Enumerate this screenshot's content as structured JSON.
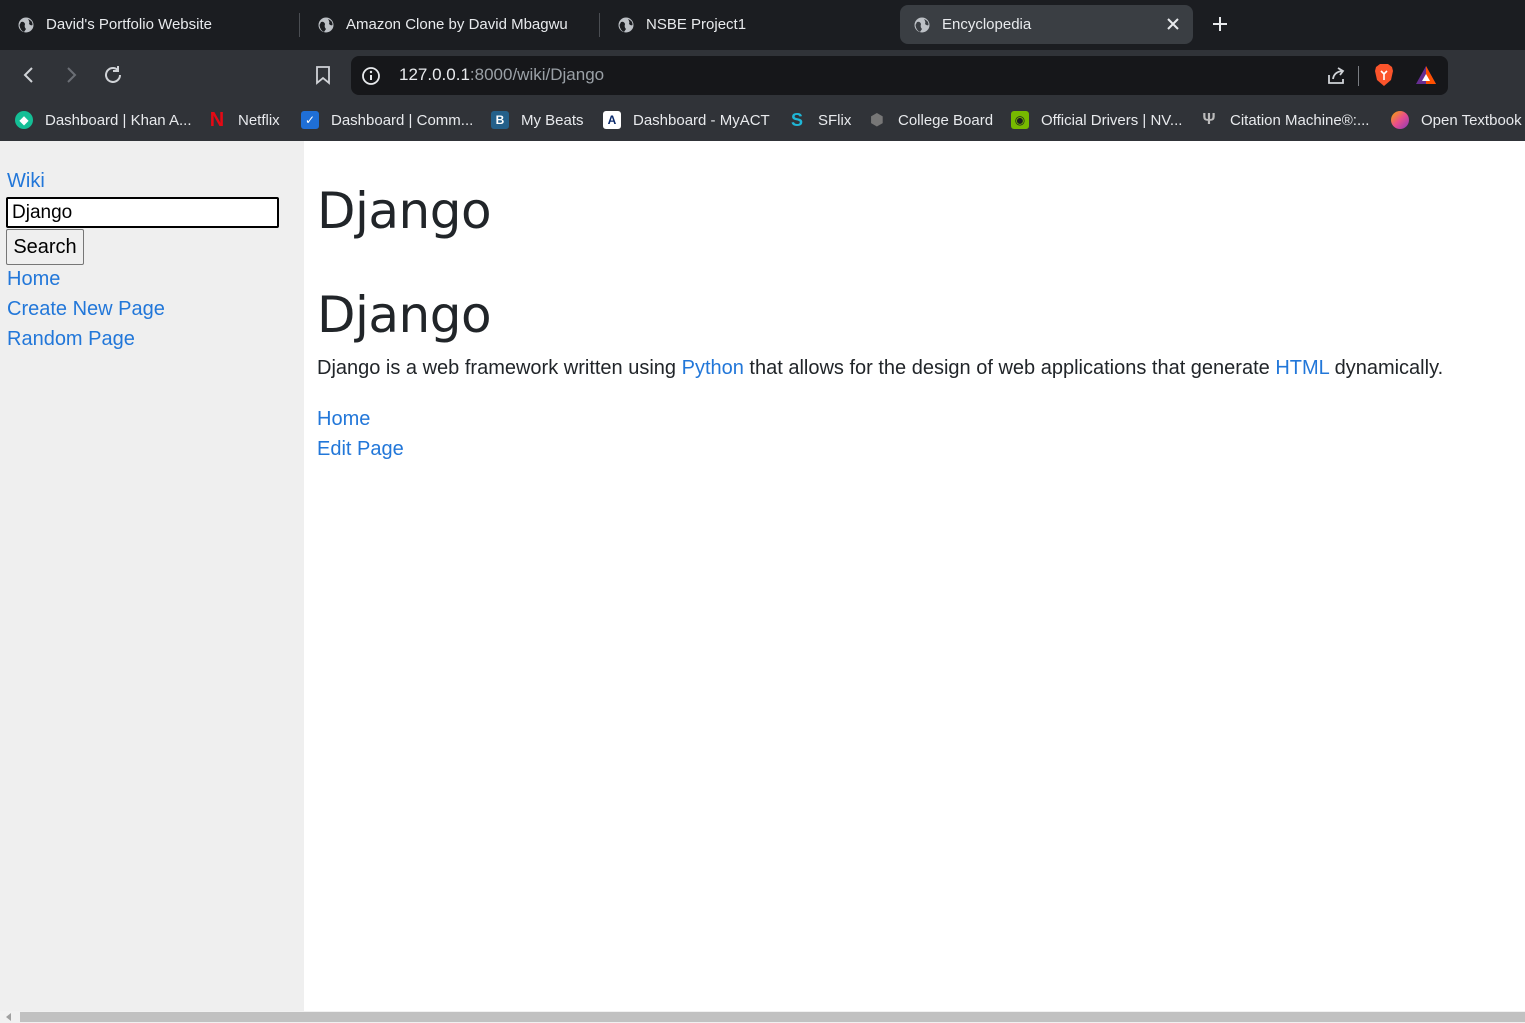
{
  "tabs": [
    {
      "title": "David's Portfolio Website"
    },
    {
      "title": "Amazon Clone by David Mbagwu"
    },
    {
      "title": "NSBE Project1"
    },
    {
      "title": "Encyclopedia"
    }
  ],
  "address_bar": {
    "host": "127.0.0.1",
    "path": ":8000/wiki/Django"
  },
  "bookmarks": [
    {
      "label": "Dashboard | Khan A...",
      "icon": "khan-academy-icon",
      "color": "#14bf96"
    },
    {
      "label": "Netflix",
      "icon": "netflix-icon",
      "color": "#e50914"
    },
    {
      "label": "Dashboard | Comm...",
      "icon": "commonlit-icon",
      "color": "#1f6fd6"
    },
    {
      "label": "My Beats",
      "icon": "beats-icon",
      "color": "#24608a"
    },
    {
      "label": "Dashboard - MyACT",
      "icon": "act-icon",
      "color": "#ffffff"
    },
    {
      "label": "SFlix",
      "icon": "sflix-icon",
      "color": "#1fb6d6"
    },
    {
      "label": "College Board",
      "icon": "collegeboard-icon",
      "color": "#3a3a3a"
    },
    {
      "label": "Official Drivers | NV...",
      "icon": "nvidia-icon",
      "color": "#76b900"
    },
    {
      "label": "Citation Machine®:...",
      "icon": "citation-machine-icon",
      "color": "#bbbbbb"
    },
    {
      "label": "Open Textbook",
      "icon": "open-textbook-icon",
      "color": "#e94e8c"
    }
  ],
  "sidebar": {
    "wiki_label": "Wiki",
    "search_value": "Django",
    "search_button": "Search",
    "links": [
      {
        "label": "Home"
      },
      {
        "label": "Create New Page"
      },
      {
        "label": "Random Page"
      }
    ]
  },
  "main": {
    "page_title": "Django",
    "article_heading": "Django",
    "paragraph": {
      "before": "Django is a web framework written using ",
      "link1": "Python",
      "middle": " that allows for the design of web applications that generate ",
      "link2": "HTML",
      "after": " dynamically."
    },
    "links": [
      {
        "label": "Home"
      },
      {
        "label": "Edit Page"
      }
    ]
  },
  "colors": {
    "link": "#2277d9",
    "sidebar_bg": "#efefef",
    "tab_strip": "#1b1d21",
    "toolbar": "#303338"
  }
}
